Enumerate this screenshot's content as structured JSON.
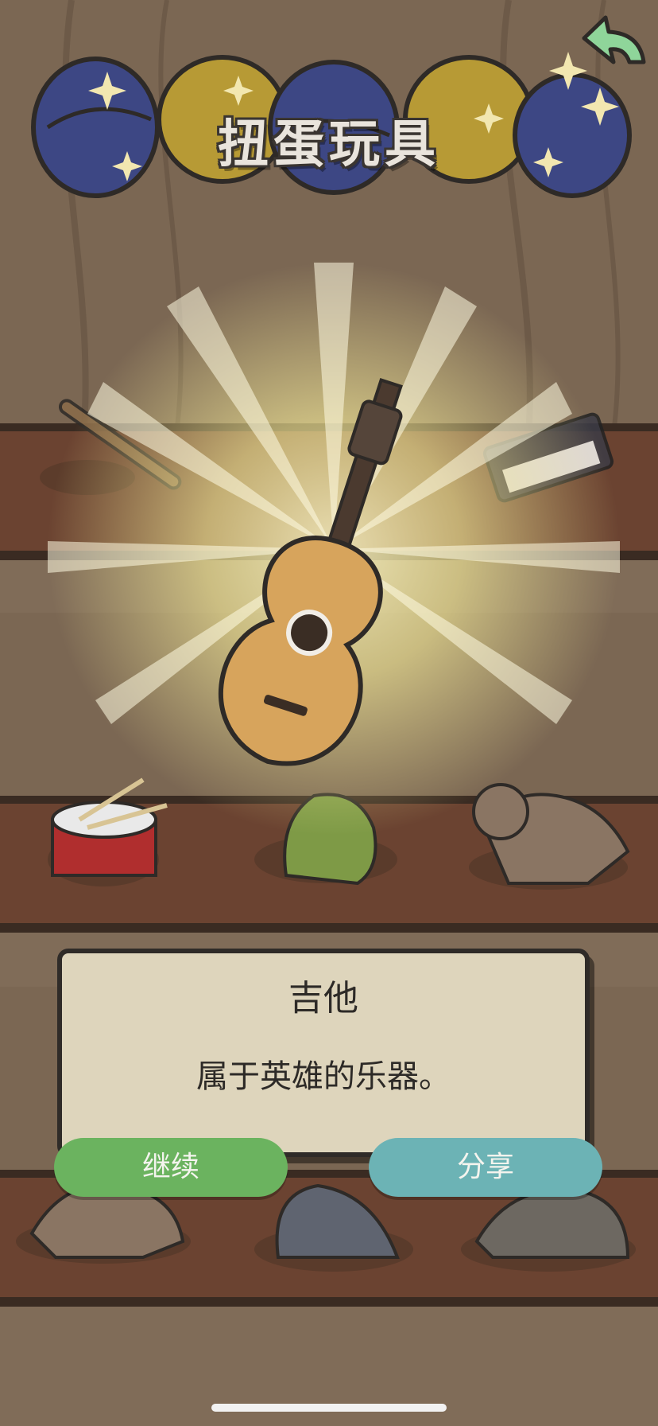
{
  "header": {
    "title": "扭蛋玩具"
  },
  "item": {
    "name": "吉他",
    "description": "属于英雄的乐器。"
  },
  "actions": {
    "continue_label": "继续",
    "share_label": "分享"
  },
  "shelf_items": [
    "flute-icon",
    "keyboard-synth-icon",
    "snare-drum-icon",
    "green-dinosaur-icon",
    "triceratops-icon",
    "stegosaurus-icon",
    "grey-dinosaur-icon",
    "ankylosaurus-icon"
  ],
  "colors": {
    "background": "#7a6652",
    "shelf": "#6e4632",
    "dialog": "#ded5bc",
    "continue_button": "#6bb35f",
    "share_button": "#6cb3b5",
    "capsule_blue": "#3d4784",
    "capsule_yellow": "#b79a35",
    "back_arrow": "#8fd59a"
  }
}
